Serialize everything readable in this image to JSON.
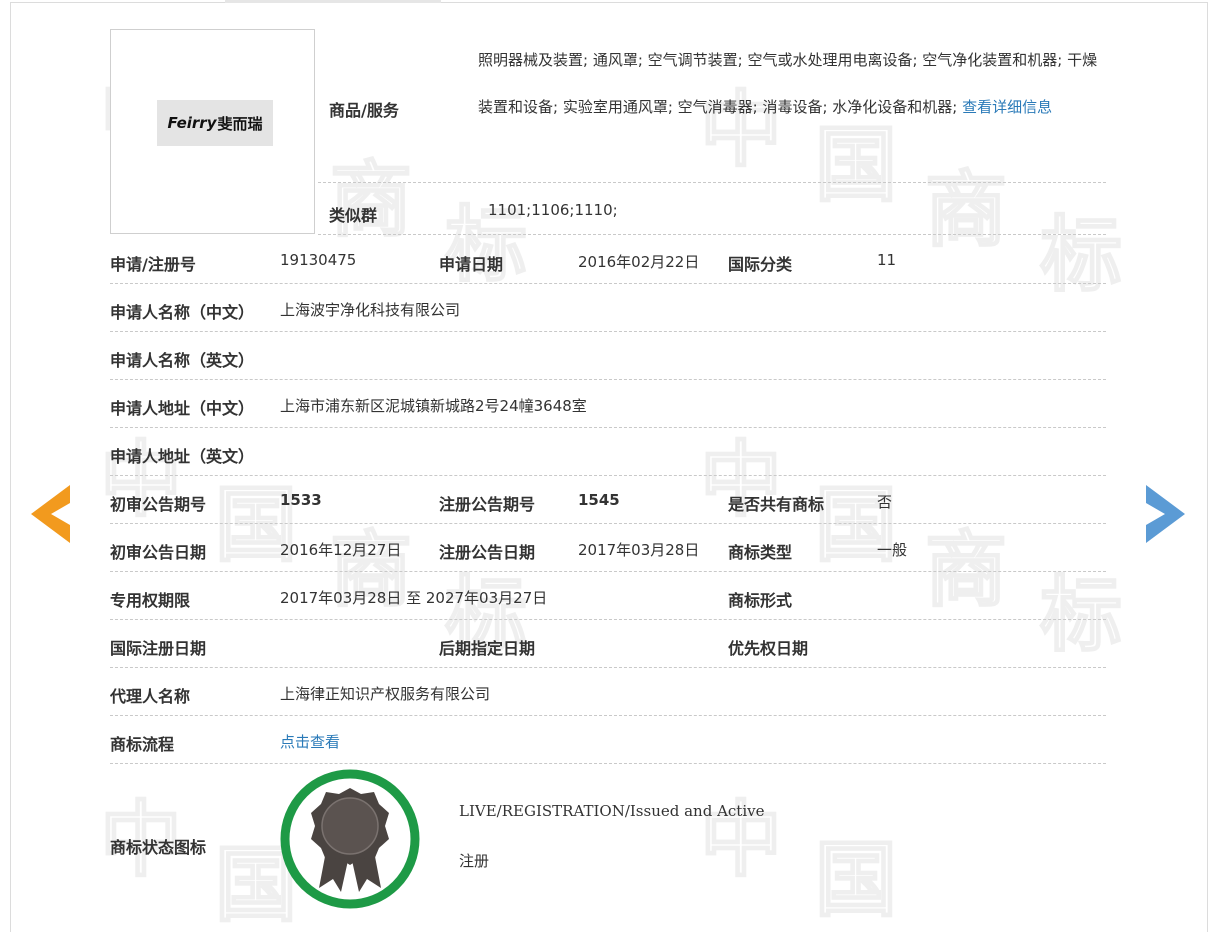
{
  "brand": {
    "logo_latin": "Feirry",
    "logo_cn": "斐而瑞"
  },
  "goods": {
    "label": "商品/服务",
    "text": "照明器械及装置; 通风罩; 空气调节装置; 空气或水处理用电离设备; 空气净化装置和机器; 干燥装置和设备; 实验室用通风罩; 空气消毒器; 消毒设备; 水净化设备和机器; ",
    "more_link": "查看详细信息"
  },
  "similar_group": {
    "label": "类似群",
    "value": "1101;1106;1110;"
  },
  "row_reg": {
    "reg_no_label": "申请/注册号",
    "reg_no": "19130475",
    "apply_date_label": "申请日期",
    "apply_date": "2016年02月22日",
    "intl_class_label": "国际分类",
    "intl_class": "11"
  },
  "applicant_cn": {
    "label": "申请人名称（中文）",
    "value": "上海波宇净化科技有限公司"
  },
  "applicant_en": {
    "label": "申请人名称（英文）",
    "value": ""
  },
  "address_cn": {
    "label": "申请人地址（中文）",
    "value": "上海市浦东新区泥城镇新城路2号24幢3648室"
  },
  "address_en": {
    "label": "申请人地址（英文）",
    "value": ""
  },
  "row_pub_no": {
    "prelim_no_label": "初审公告期号",
    "prelim_no": "1533",
    "reg_pub_no_label": "注册公告期号",
    "reg_pub_no": "1545",
    "shared_label": "是否共有商标",
    "shared": "否"
  },
  "row_pub_date": {
    "prelim_date_label": "初审公告日期",
    "prelim_date": "2016年12月27日",
    "reg_pub_date_label": "注册公告日期",
    "reg_pub_date": "2017年03月28日",
    "type_label": "商标类型",
    "type": "一般"
  },
  "row_term": {
    "term_label": "专用权期限",
    "term": "2017年03月28日 至 2027年03月27日",
    "form_label": "商标形式",
    "form": ""
  },
  "row_intl": {
    "intl_date_label": "国际注册日期",
    "intl_date": "",
    "later_label": "后期指定日期",
    "later": "",
    "priority_label": "优先权日期",
    "priority": ""
  },
  "agent": {
    "label": "代理人名称",
    "value": "上海律正知识产权服务有限公司"
  },
  "flow": {
    "label": "商标流程",
    "link": "点击查看"
  },
  "status": {
    "label": "商标状态图标",
    "en": "LIVE/REGISTRATION/Issued and Active",
    "cn": "注册"
  },
  "watermark": {
    "glyphs": [
      "中",
      "国",
      "商",
      "标"
    ]
  },
  "colors": {
    "link": "#2a7ab8",
    "prev_arrow": "#f29a1e",
    "next_arrow": "#5b9bd5",
    "seal_ring": "#1e9a46",
    "seal_body": "#4a4441"
  }
}
